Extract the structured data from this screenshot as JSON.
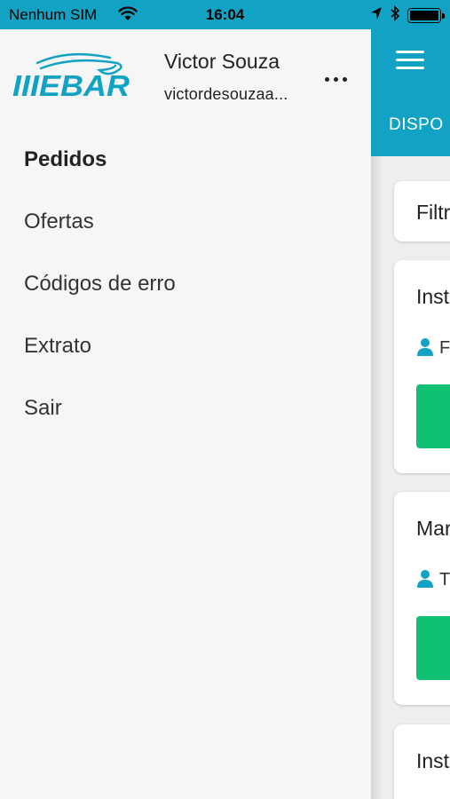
{
  "status_bar": {
    "carrier": "Nenhum SIM",
    "time": "16:04"
  },
  "drawer": {
    "logo_text": "IIIEBAR",
    "user_name": "Victor Souza",
    "user_email": "victordesouzaa...",
    "menu": [
      {
        "label": "Pedidos",
        "active": true
      },
      {
        "label": "Ofertas",
        "active": false
      },
      {
        "label": "Códigos de erro",
        "active": false
      },
      {
        "label": "Extrato",
        "active": false
      },
      {
        "label": "Sair",
        "active": false
      }
    ]
  },
  "app": {
    "tab_label": "DISPO",
    "filter_label": "Filtr",
    "cards": [
      {
        "title": "Inst",
        "person": "F"
      },
      {
        "title": "Mar",
        "person": "T"
      },
      {
        "title": "Inst"
      }
    ]
  },
  "colors": {
    "primary": "#12a3c4",
    "accent_green": "#10c173",
    "drawer_bg": "#f6f6f6",
    "body_bg": "#eeeeee"
  }
}
